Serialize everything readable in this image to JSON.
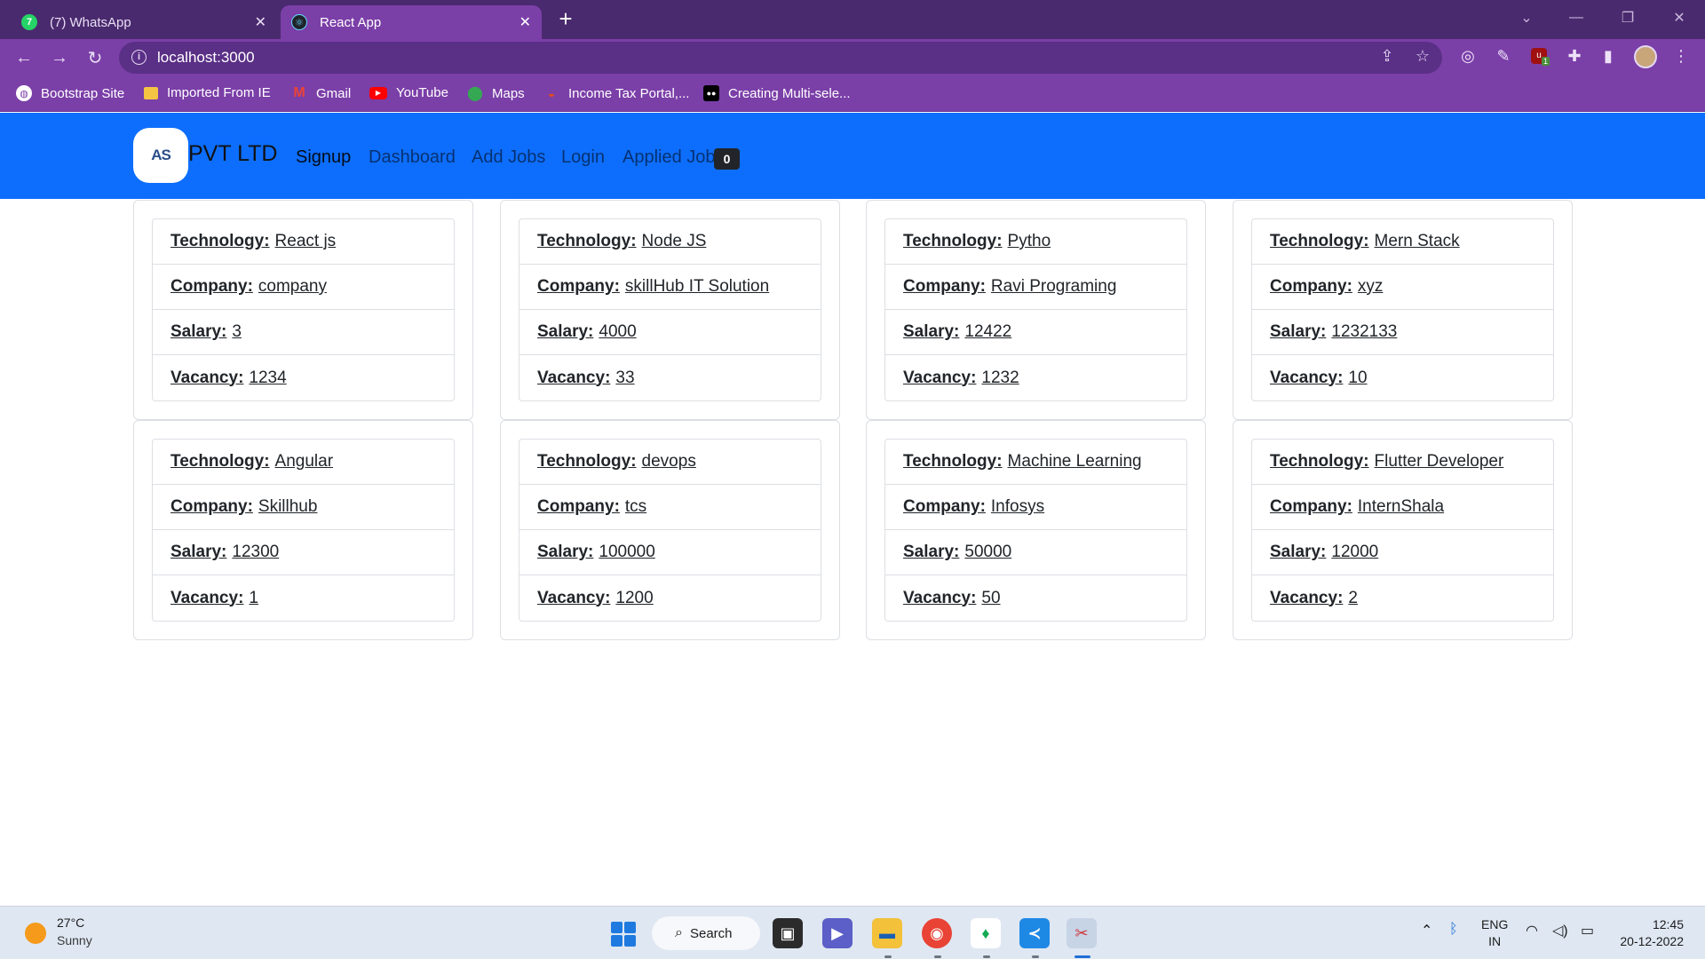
{
  "browser": {
    "tabs": [
      {
        "title": "(7) WhatsApp",
        "icon": "whatsapp-icon",
        "active": false
      },
      {
        "title": "React App",
        "icon": "react-icon",
        "active": true
      }
    ],
    "url": "localhost:3000",
    "bookmarks": [
      {
        "label": "Bootstrap Site",
        "icon": "globe-icon"
      },
      {
        "label": "Imported From IE",
        "icon": "folder-icon"
      },
      {
        "label": "Gmail",
        "icon": "gmail-icon"
      },
      {
        "label": "YouTube",
        "icon": "youtube-icon"
      },
      {
        "label": "Maps",
        "icon": "maps-icon"
      },
      {
        "label": "Income Tax Portal,...",
        "icon": "income-tax-icon"
      },
      {
        "label": "Creating Multi-sele...",
        "icon": "medium-icon"
      }
    ],
    "extension_badge": "1"
  },
  "app": {
    "logo_text": "AS",
    "brand": "PVT LTD",
    "nav": {
      "signup": "Signup",
      "dashboard": "Dashboard",
      "add_jobs": "Add Jobs",
      "login": "Login",
      "applied_job": "Applied Job",
      "applied_count": "0"
    },
    "field_labels": {
      "technology": "Technology:",
      "company": "Company:",
      "salary": "Salary:",
      "vacancy": "Vacancy:"
    },
    "jobs": [
      {
        "technology": "React js",
        "company": "company",
        "salary": "3",
        "vacancy": "1234"
      },
      {
        "technology": "Node JS",
        "company": "skillHub IT Solution",
        "salary": "4000",
        "vacancy": "33"
      },
      {
        "technology": "Pytho",
        "company": "Ravi Programing",
        "salary": "12422",
        "vacancy": "1232"
      },
      {
        "technology": "Mern Stack",
        "company": "xyz",
        "salary": "1232133",
        "vacancy": "10"
      },
      {
        "technology": "Angular",
        "company": "Skillhub",
        "salary": "12300",
        "vacancy": "1"
      },
      {
        "technology": "devops",
        "company": "tcs",
        "salary": "100000",
        "vacancy": "1200"
      },
      {
        "technology": "Machine Learning",
        "company": "Infosys",
        "salary": "50000",
        "vacancy": "50"
      },
      {
        "technology": "Flutter Developer",
        "company": "InternShala",
        "salary": "12000",
        "vacancy": "2"
      }
    ]
  },
  "taskbar": {
    "weather_temp": "27°C",
    "weather_condition": "Sunny",
    "search_label": "Search",
    "lang_line1": "ENG",
    "lang_line2": "IN",
    "time": "12:45",
    "date": "20-12-2022"
  },
  "colors": {
    "browser_frame": "#7b3fa8",
    "navbar": "#0d6efd",
    "badge": "#212529"
  }
}
